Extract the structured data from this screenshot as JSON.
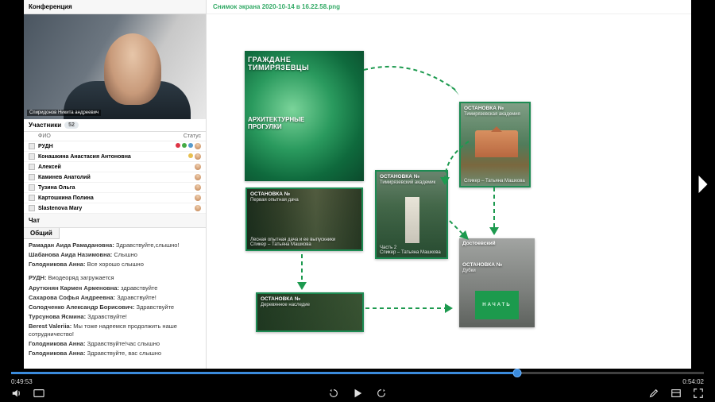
{
  "conference": {
    "title": "Конференция",
    "speaker_tag": "Спиридонов Никита андреевич"
  },
  "participants": {
    "title": "Участники",
    "count": "52",
    "col_name": "ФИО",
    "col_status": "Статус",
    "rows": [
      {
        "name": "РУДН"
      },
      {
        "name": "Конашкина Анастасия Антоновна"
      },
      {
        "name": "Алексей"
      },
      {
        "name": "Каминев Анатолий"
      },
      {
        "name": "Тузина Ольга"
      },
      {
        "name": "Картошкина Полина"
      },
      {
        "name": "Slastenova Mary"
      }
    ]
  },
  "chat": {
    "title": "Чат",
    "tab": "Общий",
    "messages": [
      {
        "author": "Рамадан Аида  Рамадановна:",
        "text": "Здравствуйте,слышно!"
      },
      {
        "author": "Шабанова Аида Назимовна:",
        "text": "Слышно"
      },
      {
        "author": "Голодникова Анна:",
        "text": "Все хорошо слышно"
      },
      {
        "gap": true
      },
      {
        "author": "РУДН:",
        "text": "Виодеоряд загружается"
      },
      {
        "author": "Арутюнян  Кармен   Арменовна:",
        "text": "здравствуйте"
      },
      {
        "author": "Сахарова  Софья   Андреевна:",
        "text": "Здравствуйте!"
      },
      {
        "author": "Солодченко Александр Борисович:",
        "text": "Здравствуйте"
      },
      {
        "author": "Турсунова Ясмина:",
        "text": "Здравствуйте!"
      },
      {
        "author": "Berest Valeriia:",
        "text": "Мы тоже надеемся продолжить наше сотрудничество!"
      },
      {
        "author": "Голодникова Анна:",
        "text": "Здравствуйте!час слышно"
      },
      {
        "author": "Голодникова Анна:",
        "text": "Здравствуйте, вас слышно"
      }
    ]
  },
  "slide": {
    "filename": "Снимок экрана 2020-10-14 в 16.22.58.png",
    "main": {
      "line1": "ГРАЖДАНЕ",
      "line2": "ТИМИРЯЗЕВЦЫ",
      "sub1": "АРХИТЕКТУРНЫЕ",
      "sub2": "ПРОГУЛКИ"
    },
    "cards": {
      "c1": {
        "head": "ОСТАНОВКА №",
        "sub": "Первая опытная дача",
        "foot1": "Лесная опытная дача и ее выпускники",
        "foot2": "Спикер – Татьяна Машкова"
      },
      "c2": {
        "head": "ОСТАНОВКА №",
        "sub": "Тимирязевский академик",
        "foot1": "Часть 2",
        "foot2": "Спикер – Татьяна Машкова"
      },
      "c3": {
        "head": "ОСТАНОВКА №",
        "sub": "Тимирязевская академия",
        "foot": "Спикер – Татьяна Машкова"
      },
      "c4": {
        "head": "Достоевский",
        "stop": "ОСТАНОВКА №",
        "sub": "Дубки",
        "btn": "НАЧАТЬ"
      },
      "c5": {
        "head": "ОСТАНОВКА №",
        "sub": "Деревянное наследие"
      }
    }
  },
  "player": {
    "elapsed": "0:49:53",
    "total": "0:54:02",
    "progress_pct": 73
  }
}
